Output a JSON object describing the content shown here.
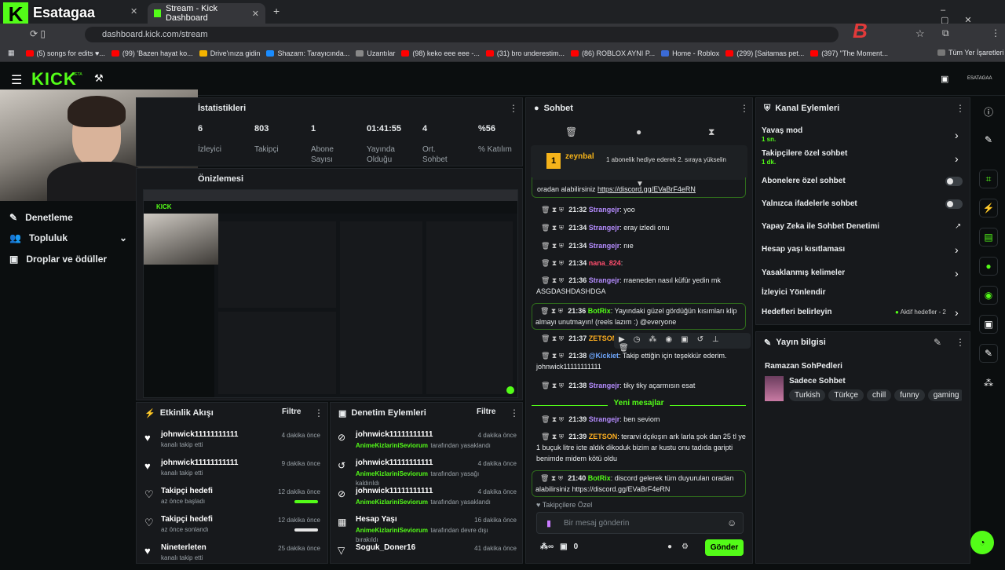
{
  "browser": {
    "tabs": [
      {
        "label": "Esatagaa"
      },
      {
        "label": "Stream - Kick Dashboard"
      }
    ],
    "url": "dashboard.kick.com/stream",
    "bookmarks": [
      "(5) songs for edits ♥...",
      "(99) 'Bazen hayat ko...",
      "Drive'ınıza gidin",
      "Shazam: Tarayıcında...",
      "Uzantılar",
      "(98) keko eee eee -...",
      "(31) bro underestim...",
      "(86) ROBLOX AYNI P...",
      "Home - Roblox",
      "(299) [Saitamas pet...",
      "(397) \"The Moment...",
      "Tüm Yer İşaretleri"
    ]
  },
  "header": {
    "logo": "KICK",
    "beta": "BETA",
    "user": "ESATAGAA"
  },
  "stats": {
    "title": "İstatistikleri",
    "items": [
      {
        "v": "6",
        "l": "İzleyici"
      },
      {
        "v": "803",
        "l": "Takipçi"
      },
      {
        "v": "1",
        "l": "Abone Sayısı"
      },
      {
        "v": "01:41:55",
        "l": "Yayında Olduğu"
      },
      {
        "v": "4",
        "l": "Ort. Sohbet"
      },
      {
        "v": "%56",
        "l": "% Katılım"
      }
    ]
  },
  "preview": {
    "title": "Önizlemesi"
  },
  "left_nav": [
    {
      "label": "Denetleme"
    },
    {
      "label": "Topluluk"
    },
    {
      "label": "Droplar ve ödüller"
    }
  ],
  "activity": {
    "title": "Etkinlik Akışı",
    "filter": "Filtre",
    "items": [
      {
        "name": "johnwick11111111111",
        "sub": "kanalı takip etti",
        "time": "4 dakika önce"
      },
      {
        "name": "johnwick11111111111",
        "sub": "kanalı takip etti",
        "time": "9 dakika önce"
      },
      {
        "name": "Takipçi hedefi",
        "sub": "az önce başladı",
        "time": "12 dakika önce"
      },
      {
        "name": "Takipçi hedefi",
        "sub": "az önce sonlandı",
        "time": "12 dakika önce"
      },
      {
        "name": "Nineterleten",
        "sub": "kanalı takip etti",
        "time": "25 dakika önce"
      }
    ]
  },
  "moderation": {
    "title": "Denetim Eylemleri",
    "filter": "Filtre",
    "items": [
      {
        "name": "johnwick11111111111",
        "by": "AnimeKizlariniSeviorum",
        "sub": "tarafından yasaklandı",
        "time": "4 dakika önce"
      },
      {
        "name": "johnwick11111111111",
        "by": "AnimeKizlariniSeviorum",
        "sub": "tarafından yasağı kaldırıldı",
        "time": "4 dakika önce"
      },
      {
        "name": "johnwick11111111111",
        "by": "AnimeKizlariniSeviorum",
        "sub": "tarafından yasaklandı",
        "time": "4 dakika önce"
      },
      {
        "name": "Hesap Yaşı",
        "by": "AnimeKizlariniSeviorum",
        "sub": "tarafından devre dışı bırakıldı",
        "time": "16 dakika önce"
      },
      {
        "name": "Soguk_Doner16",
        "by": "",
        "sub": "",
        "time": "41 dakika önce"
      }
    ]
  },
  "chat": {
    "title": "Sohbet",
    "pinned_user": "zeynbal",
    "pinned_level": "1",
    "pinned_msg": "1 abonelik hediye ederek 2. sıraya yükselin",
    "top_msg": "oradan alabilirsiniz ",
    "top_link": "https://discord.gg/EVaBrF4eRN",
    "messages": [
      {
        "t": "21:32",
        "u": "Strangejr",
        "c": "#b58cff",
        "m": "yoo"
      },
      {
        "t": "21:34",
        "u": "Strangejr",
        "c": "#b58cff",
        "m": "eray izledi onu"
      },
      {
        "t": "21:34",
        "u": "Strangejr",
        "c": "#b58cff",
        "m": "nıe"
      },
      {
        "t": "21:34",
        "u": "nana_824",
        "c": "#ff4d6d",
        "m": ""
      },
      {
        "t": "21:36",
        "u": "Strangejr",
        "c": "#b58cff",
        "m": "rraeneden nasıl küfür yedin mk ASGDASHDASHDGA"
      },
      {
        "t": "21:36",
        "u": "BotRix",
        "c": "#53fc18",
        "m": "Yayındaki güzel gördüğün kısımları klip almayı unutmayın! (reels lazım :) @everyone"
      },
      {
        "t": "21:37",
        "u": "ZETSON",
        "c": "#ffb020",
        "m": ""
      },
      {
        "t": "21:38",
        "u": "@Kickiet",
        "c": "#6fa8ff",
        "m": "Takip ettiğin için teşekkür ederim. johnwick11111111111"
      },
      {
        "t": "21:38",
        "u": "Strangejr",
        "c": "#b58cff",
        "m": "tiky tiky açarmısın esat"
      },
      {
        "t": "21:39",
        "u": "Strangejr",
        "c": "#b58cff",
        "m": "ben seviom"
      },
      {
        "t": "21:39",
        "u": "ZETSON",
        "c": "#ffb020",
        "m": "terarvi dçıkışın ark larla şok dan 25 tl ye 1 buçuk litre icte aldık dikoduk bizim ar kustu onu tadıda garipti benimde midem kötü oldu"
      },
      {
        "t": "21:40",
        "u": "BotRix",
        "c": "#53fc18",
        "m": "discord gelerek tüm duyuruları oradan alabilirsiniz https://discord.gg/EVaBrF4eRN"
      }
    ],
    "new_messages": "Yeni mesajlar",
    "followers_only": "Takipçilere Özel",
    "placeholder": "Bir mesaj gönderin",
    "points": "0",
    "send": "Gönder"
  },
  "channel_actions": {
    "title": "Kanal Eylemleri",
    "items": [
      {
        "label": "Yavaş mod",
        "sub": "1 sn."
      },
      {
        "label": "Takipçilere özel sohbet",
        "sub": "1 dk."
      },
      {
        "label": "Abonelere özel sohbet",
        "sub": ""
      },
      {
        "label": "Yalnızca ifadelerle sohbet",
        "sub": ""
      },
      {
        "label": "Yapay Zeka ile Sohbet Denetimi",
        "sub": ""
      },
      {
        "label": "Hesap yaşı kısıtlaması",
        "sub": ""
      },
      {
        "label": "Yasaklanmış kelimeler",
        "sub": ""
      },
      {
        "label": "İzleyici Yönlendir",
        "sub": ""
      },
      {
        "label": "Hedefleri belirleyin",
        "sub": ""
      }
    ],
    "goals_badge": "Aktif hedefler - 2"
  },
  "stream_info": {
    "title": "Yayın bilgisi",
    "stream_title": "Ramazan SohPedleri",
    "category": "Sadece Sohbet",
    "tags": [
      "Turkish",
      "Türkçe",
      "chill",
      "funny",
      "gaming"
    ]
  },
  "colors": {
    "accent": "#53fc18",
    "bg": "#0b0e0f",
    "panel": "#17191c"
  }
}
